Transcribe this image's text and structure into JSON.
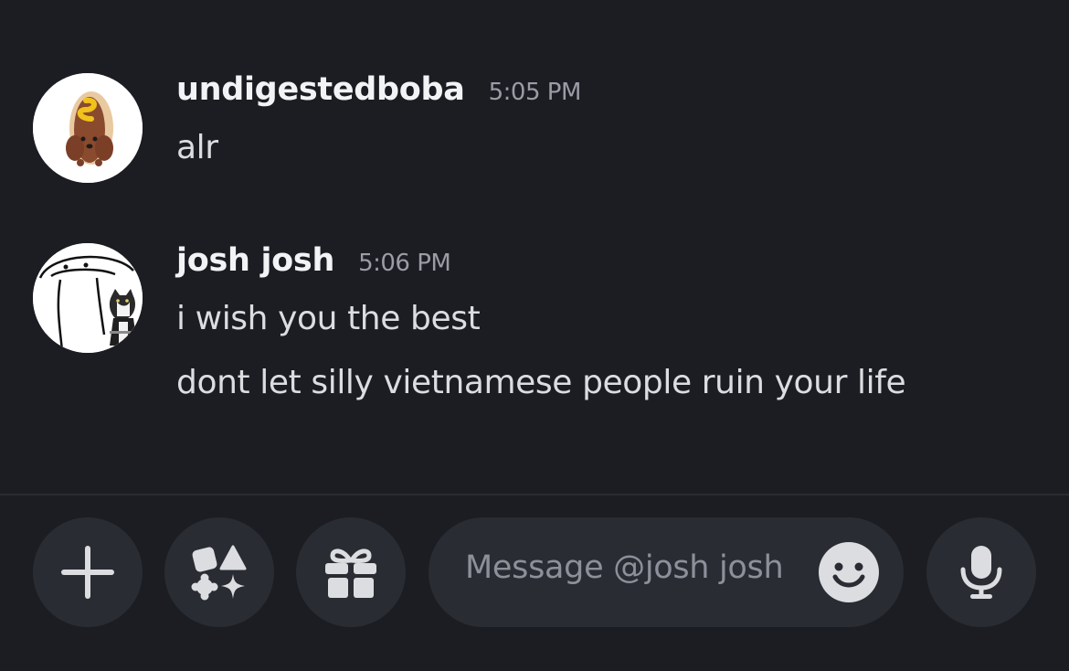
{
  "messages": [
    {
      "author": "undigestedboba",
      "timestamp": "5:05 PM",
      "lines": [
        "alr"
      ]
    },
    {
      "author": "josh josh",
      "timestamp": "5:06 PM",
      "lines": [
        "i wish you the best",
        "dont let silly vietnamese people ruin your life"
      ]
    }
  ],
  "composer": {
    "placeholder": "Message @josh josh",
    "buttons": [
      "plus-icon",
      "apps-icon",
      "gift-icon",
      "emoji-icon",
      "microphone-icon"
    ]
  },
  "colors": {
    "background": "#1c1d22",
    "button_background": "#2a2c33",
    "author_text": "#f2f3f5",
    "timestamp_text": "#9a9ca6",
    "icon": "#dcdde1"
  }
}
